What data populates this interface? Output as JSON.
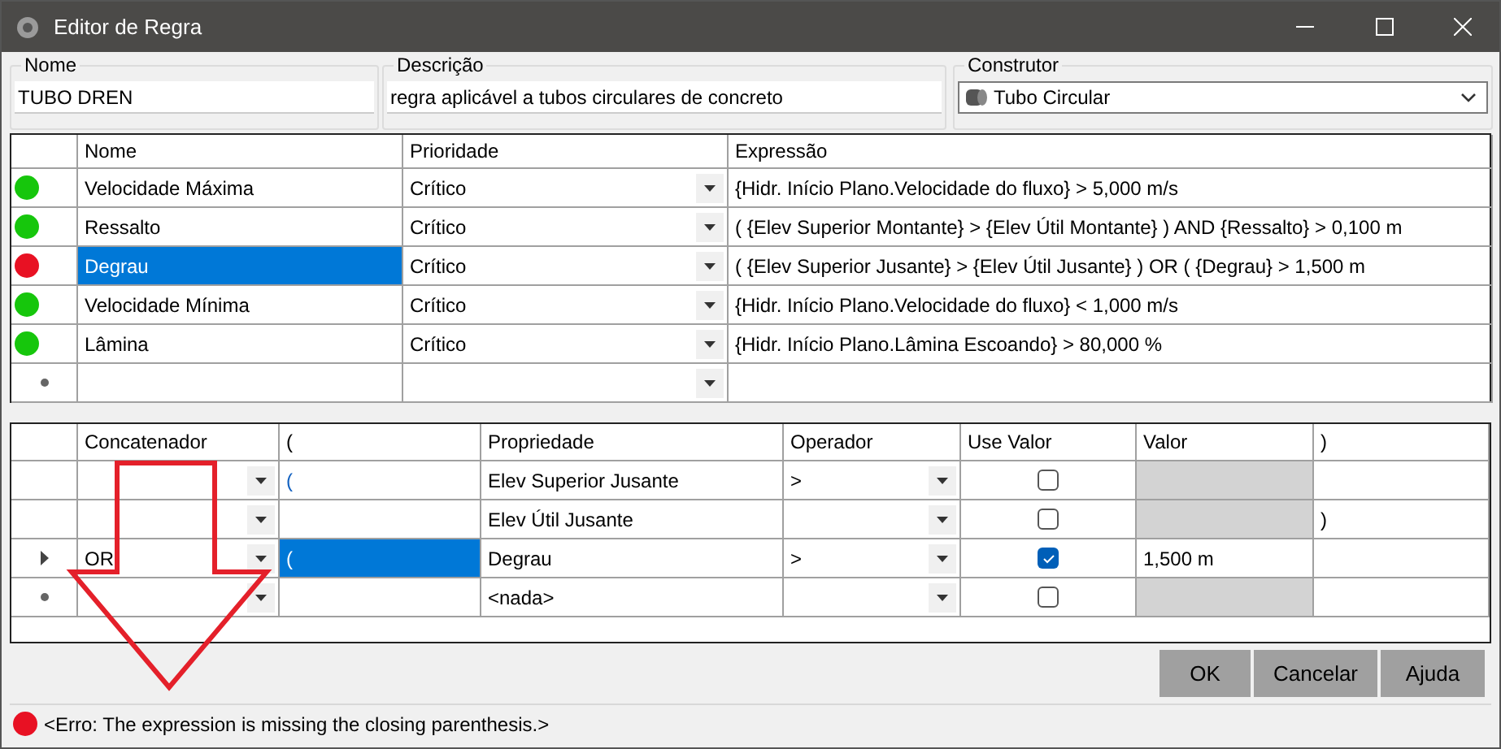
{
  "window": {
    "title": "Editor de Regra"
  },
  "fields": {
    "nome": {
      "label": "Nome",
      "value": "TUBO DREN"
    },
    "descricao": {
      "label": "Descrição",
      "value": "regra aplicável a tubos circulares de concreto"
    },
    "construtor": {
      "label": "Construtor",
      "value": "Tubo Circular"
    }
  },
  "rules": {
    "columns": [
      "Nome",
      "Prioridade",
      "Expressão"
    ],
    "rows": [
      {
        "color": "#16c60c",
        "name": "Velocidade Máxima",
        "priority": "Crítico",
        "expression": "{Hidr. Início Plano.Velocidade do fluxo} > 5,000 m/s",
        "selected": false
      },
      {
        "color": "#16c60c",
        "name": "Ressalto",
        "priority": "Crítico",
        "expression": "( {Elev Superior Montante} >  {Elev Útil Montante} )  AND {Ressalto} > 0,100 m",
        "selected": false
      },
      {
        "color": "#e81123",
        "name": "Degrau",
        "priority": "Crítico",
        "expression": "( {Elev Superior Jusante} >  {Elev Útil Jusante} )  OR ( {Degrau} > 1,500 m",
        "selected": true
      },
      {
        "color": "#16c60c",
        "name": "Velocidade Mínima",
        "priority": "Crítico",
        "expression": "{Hidr. Início Plano.Velocidade do fluxo} < 1,000 m/s",
        "selected": false
      },
      {
        "color": "#16c60c",
        "name": "Lâmina",
        "priority": "Crítico",
        "expression": "{Hidr. Início Plano.Lâmina Escoando} > 80,000 %",
        "selected": false
      }
    ]
  },
  "conditions": {
    "columns": [
      "Concatenador",
      "(",
      "Propriedade",
      "Operador",
      "Use Valor",
      "Valor",
      ")"
    ],
    "rows": [
      {
        "concat": "",
        "open": "(",
        "property": "Elev Superior Jusante",
        "operator": ">",
        "use_value": false,
        "value": "",
        "close": "",
        "selected": false,
        "new": false
      },
      {
        "concat": "",
        "open": "",
        "property": "Elev Útil Jusante",
        "operator": "",
        "use_value": false,
        "value": "",
        "close": ")",
        "selected": false,
        "new": false
      },
      {
        "concat": "OR",
        "open": "(",
        "property": "Degrau",
        "operator": ">",
        "use_value": true,
        "value": "1,500 m",
        "close": "",
        "selected": true,
        "new": false
      },
      {
        "concat": "",
        "open": "",
        "property": "<nada>",
        "operator": "",
        "use_value": false,
        "value": "",
        "close": "",
        "selected": false,
        "new": true
      }
    ]
  },
  "buttons": [
    "OK",
    "Cancelar",
    "Ajuda"
  ],
  "status": {
    "color": "#e81123",
    "message": "<Erro: The expression is missing the closing parenthesis.>"
  }
}
